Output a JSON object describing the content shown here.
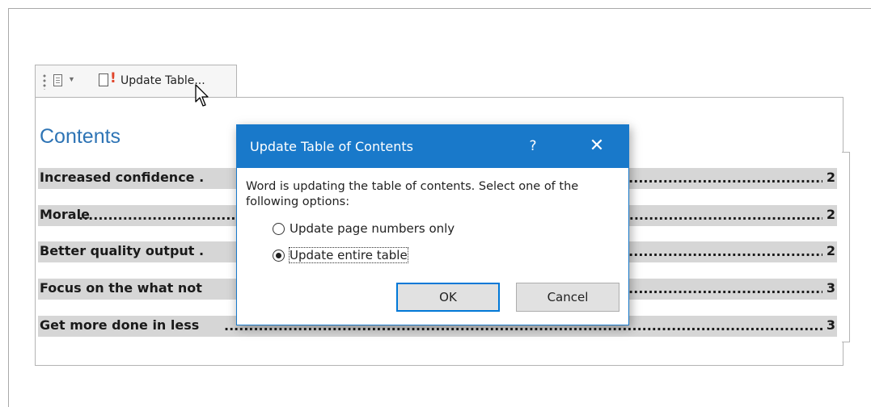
{
  "toolbar": {
    "update_table_label": "Update Table...",
    "grip_icon": "grip-dots-icon",
    "doc_icon": "document-icon",
    "dropdown_icon": "chevron-down-icon",
    "update_icon": "update-document-icon"
  },
  "toc": {
    "heading": "Contents",
    "heading_color": "#2e74b5",
    "highlight_color": "#d6d6d6",
    "entries": [
      {
        "title": "Increased confidence .",
        "page": "2"
      },
      {
        "title": "Morale",
        "page": "2"
      },
      {
        "title": "Better quality output .",
        "page": "2"
      },
      {
        "title": "Focus on the what not",
        "page": "3"
      },
      {
        "title": "Get more done in less",
        "page": "3"
      }
    ],
    "leader_text": "............................................................................................................................................................................................"
  },
  "dialog": {
    "title": "Update Table of Contents",
    "help_label": "?",
    "close_label": "✕",
    "accent_color": "#1979ca",
    "message": "Word is updating the table of contents.  Select one of the following options:",
    "options": [
      {
        "label": "Update page numbers only",
        "selected": false
      },
      {
        "label": "Update entire table",
        "selected": true
      }
    ],
    "ok_label": "OK",
    "cancel_label": "Cancel"
  }
}
